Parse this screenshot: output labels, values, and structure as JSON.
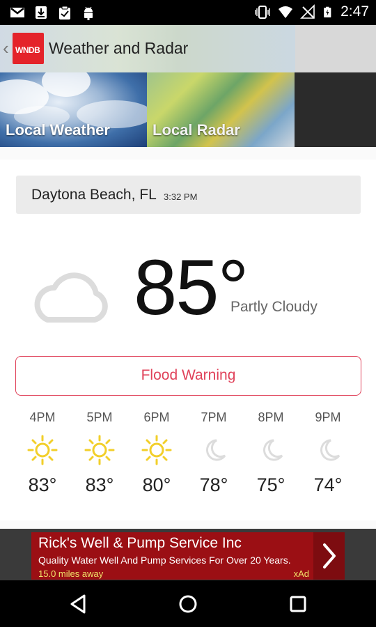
{
  "statusbar": {
    "time": "2:47",
    "left_icons": [
      "gmail-icon",
      "download-icon",
      "clipboard-check-icon",
      "android-icon"
    ],
    "right_icons": [
      "vibrate-icon",
      "wifi-icon",
      "no-signal-icon",
      "battery-charging-icon"
    ]
  },
  "appbar": {
    "back_glyph": "‹",
    "logo_text": "WNDB",
    "title": "Weather and Radar"
  },
  "tabs": [
    {
      "label": "Local Weather",
      "selected": true
    },
    {
      "label": "Local Radar",
      "selected": false
    }
  ],
  "accent_color": "#2a7fdc",
  "current": {
    "location": "Daytona Beach, FL",
    "time": "3:32 PM",
    "temperature": "85°",
    "condition": "Partly Cloudy",
    "icon": "cloud-icon"
  },
  "alert": {
    "label": "Flood Warning",
    "color": "#e0425a"
  },
  "hourly": [
    {
      "hour": "4PM",
      "icon": "sun-icon",
      "temp": "83°"
    },
    {
      "hour": "5PM",
      "icon": "sun-icon",
      "temp": "83°"
    },
    {
      "hour": "6PM",
      "icon": "sun-icon",
      "temp": "80°"
    },
    {
      "hour": "7PM",
      "icon": "moon-icon",
      "temp": "78°"
    },
    {
      "hour": "8PM",
      "icon": "moon-icon",
      "temp": "75°"
    },
    {
      "hour": "9PM",
      "icon": "moon-icon",
      "temp": "74°"
    }
  ],
  "ad": {
    "title": "Rick's Well & Pump Service Inc",
    "subtitle": "Quality Water Well And Pump Services For Over 20 Years.",
    "distance": "15.0 miles away",
    "brand": "xAd",
    "arrow_glyph": "›"
  },
  "navbar": {
    "buttons": [
      "back-icon",
      "home-icon",
      "recents-icon"
    ]
  }
}
